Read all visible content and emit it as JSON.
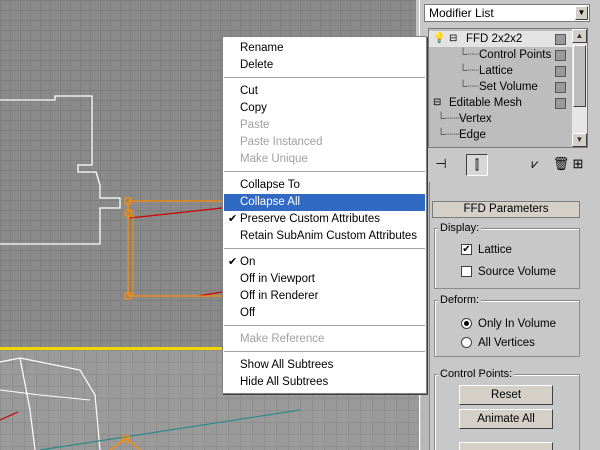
{
  "modifier_list": {
    "label": "Modifier List"
  },
  "stack": {
    "items": [
      {
        "label": "FFD 2x2x2"
      },
      {
        "label": "Control Points"
      },
      {
        "label": "Lattice"
      },
      {
        "label": "Set Volume"
      },
      {
        "label": "Editable Mesh"
      },
      {
        "label": "Vertex"
      },
      {
        "label": "Edge"
      }
    ]
  },
  "context_menu": {
    "items": [
      {
        "label": "Rename"
      },
      {
        "label": "Delete"
      },
      {
        "label": "Cut"
      },
      {
        "label": "Copy"
      },
      {
        "label": "Paste"
      },
      {
        "label": "Paste Instanced"
      },
      {
        "label": "Make Unique"
      },
      {
        "label": "Collapse To"
      },
      {
        "label": "Collapse All"
      },
      {
        "label": "Preserve Custom Attributes"
      },
      {
        "label": "Retain SubAnim Custom Attributes"
      },
      {
        "label": "On"
      },
      {
        "label": "Off in Viewport"
      },
      {
        "label": "Off in Renderer"
      },
      {
        "label": "Off"
      },
      {
        "label": "Make Reference"
      },
      {
        "label": "Show All Subtrees"
      },
      {
        "label": "Hide All Subtrees"
      }
    ]
  },
  "rollout": {
    "title": "FFD Parameters",
    "display": {
      "label": "Display:",
      "lattice": "Lattice",
      "source_volume": "Source Volume"
    },
    "deform": {
      "label": "Deform:",
      "only_in_volume": "Only In Volume",
      "all_vertices": "All Vertices"
    },
    "control_points": {
      "label": "Control Points:",
      "reset": "Reset",
      "animate_all": "Animate All"
    }
  },
  "colors": {
    "highlight": "#316ac5",
    "viewport_border": "#f2d600",
    "lattice": "#ff8c00",
    "spline": "#cc0000"
  },
  "icons": [
    "pin-icon",
    "show-end-result-icon",
    "make-unique-icon",
    "remove-modifier-icon",
    "configure-sets-icon"
  ]
}
